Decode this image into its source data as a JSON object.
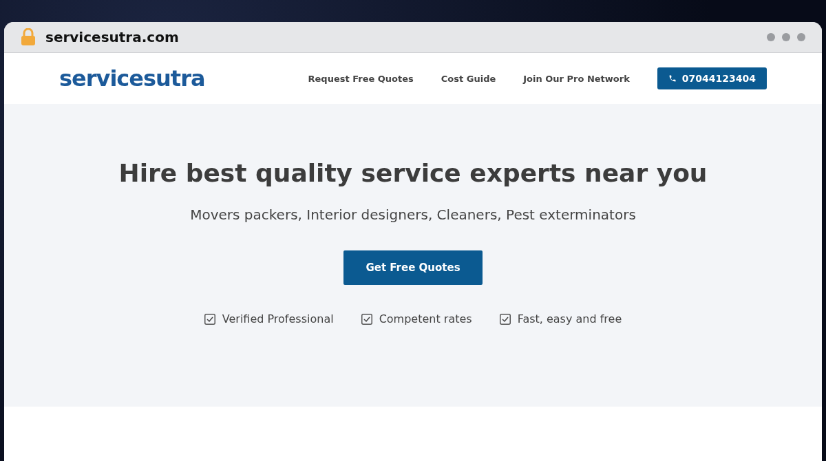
{
  "browser": {
    "url": "servicesutra.com"
  },
  "header": {
    "logo": "servicesutra",
    "nav": [
      "Request Free Quotes",
      "Cost Guide",
      "Join Our Pro Network"
    ],
    "phone": "07044123404"
  },
  "hero": {
    "title": "Hire best quality service experts near you",
    "subtitle": "Movers packers, Interior designers, Cleaners, Pest exterminators",
    "cta": "Get Free Quotes",
    "features": [
      {
        "label": "Verified Professional",
        "checked": true
      },
      {
        "label": "Competent rates",
        "checked": true
      },
      {
        "label": "Fast, easy and free",
        "checked": true
      }
    ]
  }
}
